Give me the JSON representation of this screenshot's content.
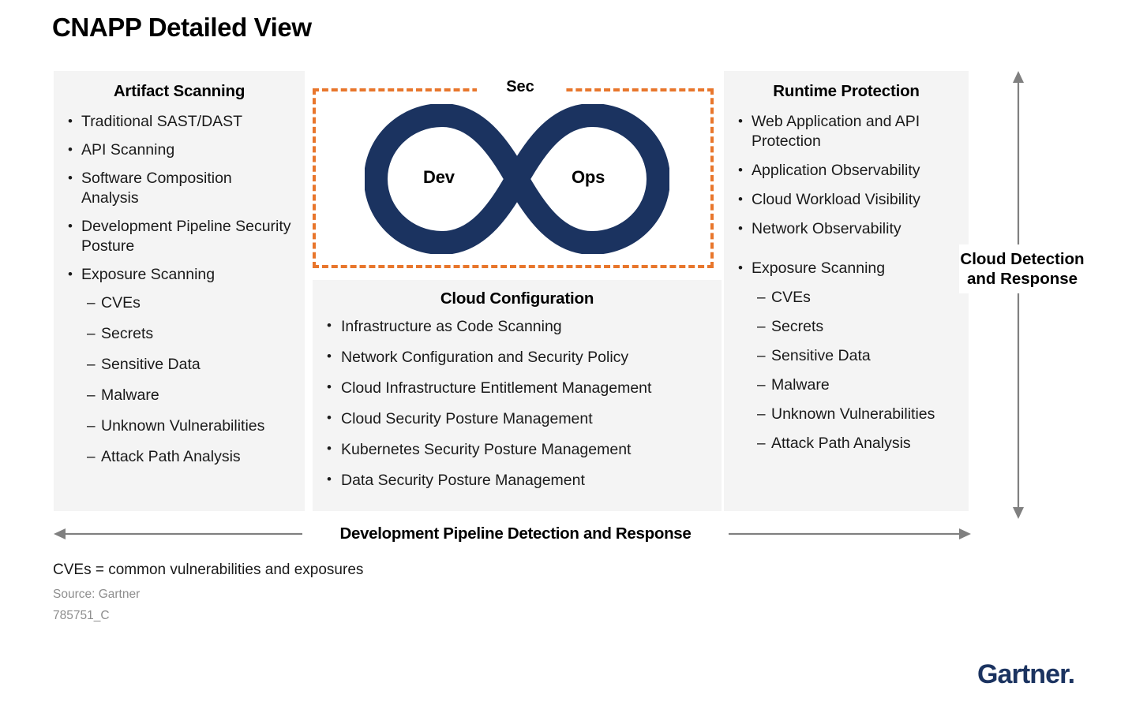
{
  "page": {
    "title": "CNAPP Detailed View"
  },
  "colors": {
    "panel_background": "#f4f4f4",
    "accent_orange": "#e8762c",
    "brand_navy": "#1b3360",
    "arrow_gray": "#808080",
    "muted_text": "#8e8e8e"
  },
  "panels": {
    "artifact_scanning": {
      "heading": "Artifact Scanning",
      "items": [
        {
          "text": "Traditional SAST/DAST",
          "level": 1
        },
        {
          "text": "API Scanning",
          "level": 1
        },
        {
          "text": "Software Composition Analysis",
          "level": 1
        },
        {
          "text": "Development Pipeline Security Posture",
          "level": 1
        },
        {
          "text": "Exposure Scanning",
          "level": 1
        },
        {
          "text": "CVEs",
          "level": 2
        },
        {
          "text": "Secrets",
          "level": 2
        },
        {
          "text": "Sensitive Data",
          "level": 2
        },
        {
          "text": "Malware",
          "level": 2
        },
        {
          "text": "Unknown Vulnerabilities",
          "level": 2
        },
        {
          "text": "Attack Path Analysis",
          "level": 2
        }
      ]
    },
    "cloud_configuration": {
      "heading": "Cloud Configuration",
      "items": [
        {
          "text": "Infrastructure as Code Scanning",
          "level": 1
        },
        {
          "text": "Network Configuration and Security Policy",
          "level": 1
        },
        {
          "text": "Cloud Infrastructure Entitlement Management",
          "level": 1
        },
        {
          "text": "Cloud Security Posture Management",
          "level": 1
        },
        {
          "text": "Kubernetes Security Posture Management",
          "level": 1
        },
        {
          "text": "Data Security Posture Management",
          "level": 1
        }
      ]
    },
    "runtime_protection": {
      "heading": "Runtime Protection",
      "items": [
        {
          "text": "Web Application and API Protection",
          "level": 1
        },
        {
          "text": "Application Observability",
          "level": 1
        },
        {
          "text": "Cloud Workload Visibility",
          "level": 1
        },
        {
          "text": "Network Observability",
          "level": 1
        },
        {
          "text": "Exposure Scanning",
          "level": 1
        },
        {
          "text": "CVEs",
          "level": 2
        },
        {
          "text": "Secrets",
          "level": 2
        },
        {
          "text": "Sensitive Data",
          "level": 2
        },
        {
          "text": "Malware",
          "level": 2
        },
        {
          "text": "Unknown Vulnerabilities",
          "level": 2
        },
        {
          "text": "Attack Path Analysis",
          "level": 2
        }
      ]
    }
  },
  "devsecops": {
    "sec_label": "Sec",
    "dev_label": "Dev",
    "ops_label": "Ops"
  },
  "arrows": {
    "vertical_label": "Cloud Detection and Response",
    "horizontal_label": "Development Pipeline Detection and Response"
  },
  "footnotes": {
    "definition": "CVEs = common vulnerabilities and exposures",
    "source": "Source: Gartner",
    "document_id": "785751_C"
  },
  "branding": {
    "logo_text": "Gartner."
  }
}
